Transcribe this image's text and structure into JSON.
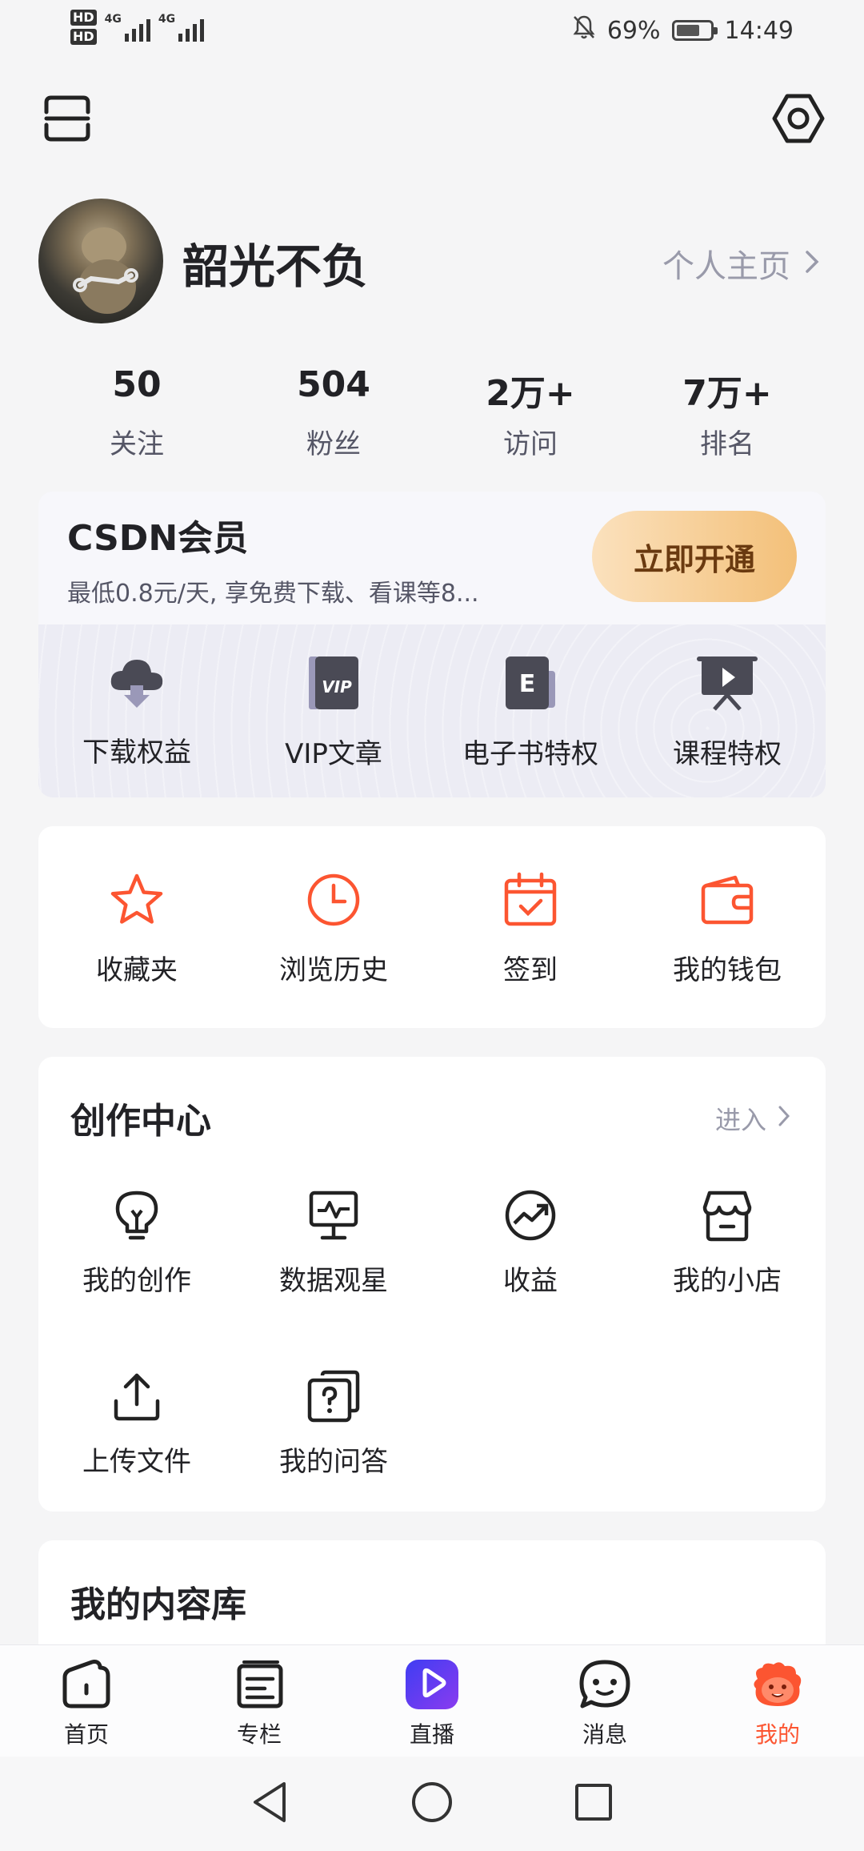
{
  "status_bar": {
    "hd1": "HD",
    "hd2": "HD",
    "net1": "4G",
    "net2": "4G",
    "battery": "69%",
    "battery_level": 0.69,
    "time": "14:49"
  },
  "profile": {
    "username": "韶光不负",
    "homepage_link": "个人主页"
  },
  "stats": [
    {
      "value": "50",
      "label": "关注"
    },
    {
      "value": "504",
      "label": "粉丝"
    },
    {
      "value": "2万+",
      "label": "访问"
    },
    {
      "value": "7万+",
      "label": "排名"
    }
  ],
  "vip": {
    "title": "CSDN会员",
    "subtitle": "最低0.8元/天, 享免费下载、看课等8...",
    "button": "立即开通",
    "items": [
      {
        "label": "下载权益",
        "icon": "cloud-download-icon"
      },
      {
        "label": "VIP文章",
        "icon": "vip-book-icon"
      },
      {
        "label": "电子书特权",
        "icon": "ebook-icon"
      },
      {
        "label": "课程特权",
        "icon": "course-screen-icon"
      }
    ]
  },
  "quick": [
    {
      "label": "收藏夹",
      "icon": "star-icon"
    },
    {
      "label": "浏览历史",
      "icon": "clock-icon"
    },
    {
      "label": "签到",
      "icon": "calendar-check-icon"
    },
    {
      "label": "我的钱包",
      "icon": "wallet-icon"
    }
  ],
  "creation": {
    "title": "创作中心",
    "enter": "进入",
    "items": [
      {
        "label": "我的创作",
        "icon": "lightbulb-icon"
      },
      {
        "label": "数据观星",
        "icon": "monitor-chart-icon"
      },
      {
        "label": "收益",
        "icon": "trend-circle-icon"
      },
      {
        "label": "我的小店",
        "icon": "shop-icon"
      },
      {
        "label": "上传文件",
        "icon": "upload-icon"
      },
      {
        "label": "我的问答",
        "icon": "question-cards-icon"
      }
    ]
  },
  "library": {
    "title": "我的内容库"
  },
  "bottom_nav": [
    {
      "label": "首页",
      "icon": "home-icon"
    },
    {
      "label": "专栏",
      "icon": "column-icon"
    },
    {
      "label": "直播",
      "icon": "live-play-icon"
    },
    {
      "label": "消息",
      "icon": "message-icon"
    },
    {
      "label": "我的",
      "icon": "mascot-icon",
      "active": true
    }
  ],
  "colors": {
    "accent": "#fc5531",
    "vip_button_start": "#fbe1bd",
    "vip_button_end": "#f3c079",
    "live_icon": "#5b3cf5"
  }
}
